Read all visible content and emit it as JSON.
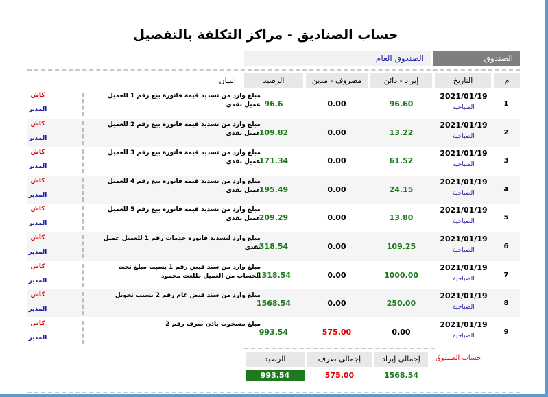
{
  "page": {
    "title": "حساب الصناديق - مراكز التكلفة بالتفصيل"
  },
  "fund": {
    "label": "الصندوق",
    "value": "الصندوق العام"
  },
  "columns": {
    "index": "م",
    "date": "التاريخ",
    "revenue": "إيراد - دائن",
    "expense": "مصروف - مدين",
    "balance": "الرصيد",
    "statement": "البيان"
  },
  "rows": [
    {
      "index": "1",
      "date": "2021/01/19",
      "period": "الصباحية",
      "revenue": "96.60",
      "expense": "0.00",
      "balance": "96.6",
      "statement": "مبلغ وارد من تسديد قيمة فاتورة بيع رقم 1 للعميل عميل نقدي",
      "payment": "كاش",
      "user": "المدير"
    },
    {
      "index": "2",
      "date": "2021/01/19",
      "period": "الصباحية",
      "revenue": "13.22",
      "expense": "0.00",
      "balance": "109.82",
      "statement": "مبلغ وارد من تسديد قيمة فاتورة بيع رقم 2 للعميل عميل نقدي",
      "payment": "كاش",
      "user": "المدير"
    },
    {
      "index": "3",
      "date": "2021/01/19",
      "period": "الصباحية",
      "revenue": "61.52",
      "expense": "0.00",
      "balance": "171.34",
      "statement": "مبلغ وارد من تسديد قيمة فاتورة بيع رقم 3 للعميل عميل نقدي",
      "payment": "كاش",
      "user": "المدير"
    },
    {
      "index": "4",
      "date": "2021/01/19",
      "period": "الصباحية",
      "revenue": "24.15",
      "expense": "0.00",
      "balance": "195.49",
      "statement": "مبلغ وارد من تسديد قيمة فاتورة بيع رقم 4 للعميل عميل نقدي",
      "payment": "كاش",
      "user": "المدير"
    },
    {
      "index": "5",
      "date": "2021/01/19",
      "period": "الصباحية",
      "revenue": "13.80",
      "expense": "0.00",
      "balance": "209.29",
      "statement": "مبلغ وارد من تسديد قيمة فاتورة بيع رقم 5 للعميل عميل نقدي",
      "payment": "كاش",
      "user": "المدير"
    },
    {
      "index": "6",
      "date": "2021/01/19",
      "period": "الصباحية",
      "revenue": "109.25",
      "expense": "0.00",
      "balance": "318.54",
      "statement": "مبلغ وارد لتسديد فاتورة خدمات رقم 1 للعميل عميل نقدي",
      "payment": "كاش",
      "user": "المدير"
    },
    {
      "index": "7",
      "date": "2021/01/19",
      "period": "الصباحية",
      "revenue": "1000.00",
      "expense": "0.00",
      "balance": "1318.54",
      "statement": "مبلغ وارد من سند قبض رقم 1 بسبب مبلغ تحت الحساب من العميل طلعت محمود",
      "payment": "كاش",
      "user": "المدير"
    },
    {
      "index": "8",
      "date": "2021/01/19",
      "period": "الصباحية",
      "revenue": "250.00",
      "expense": "0.00",
      "balance": "1568.54",
      "statement": "مبلغ وارد من سند قبض عام رقم 2 بسبب تحويل",
      "payment": "كاش",
      "user": "المدير"
    },
    {
      "index": "9",
      "date": "2021/01/19",
      "period": "الصباحية",
      "revenue": "0.00",
      "expense": "575.00",
      "balance": "993.54",
      "statement": "مبلغ مسحوب باذن صرف رقم 2",
      "payment": "كاش",
      "user": "المدير"
    }
  ],
  "totals": {
    "label": "حساب الصندوق",
    "revenue_label": "إجمالي إيراد",
    "expense_label": "إجمالي صرف",
    "balance_label": "الرصيد",
    "revenue": "1568.54",
    "expense": "575.00",
    "balance": "993.54"
  },
  "colors": {
    "revenue": "#1f7a1f",
    "expense": "#e00000",
    "balance_highlight": "#1f7a1f"
  }
}
